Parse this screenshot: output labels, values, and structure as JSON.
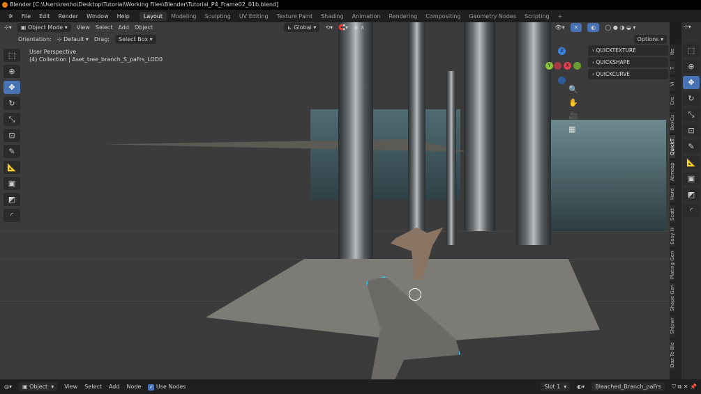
{
  "title": "Blender [C:\\Users\\renho\\Desktop\\Tutorial\\Working Files\\Blender\\Tutorial_P4_Frame02_01b.blend]",
  "menu": [
    "File",
    "Edit",
    "Render",
    "Window",
    "Help"
  ],
  "workspaces": [
    "Layout",
    "Modeling",
    "Sculpting",
    "UV Editing",
    "Texture Paint",
    "Shading",
    "Animation",
    "Rendering",
    "Compositing",
    "Geometry Nodes",
    "Scripting",
    "+"
  ],
  "header": {
    "mode": "Object Mode",
    "items": [
      "View",
      "Select",
      "Add",
      "Object"
    ],
    "orientation": "Global"
  },
  "tool_settings": {
    "orientation_label": "Orientation:",
    "orientation_value": "Default",
    "drag_label": "Drag:",
    "drag_value": "Select Box",
    "options": "Options"
  },
  "viewport": {
    "perspective": "User Perspective",
    "collection": "(4) Collection | Aset_tree_branch_S_paFrs_LOD0"
  },
  "gizmo": {
    "z": "Z",
    "y": "Y",
    "x": "X"
  },
  "panels": [
    "QUICKTEXTURE",
    "QUICKSHAPE",
    "QUICKCURVE"
  ],
  "side_tabs": [
    "Ite",
    "T",
    "Vi",
    "Cre",
    "BoxCu",
    "QuickT",
    "Atmosp",
    "Hard",
    "Scatt",
    "Easy H",
    "Plating Gen",
    "Shape Gen",
    "Shipwr",
    "Daz To Ble"
  ],
  "bottom": {
    "mode": "Object",
    "items": [
      "View",
      "Select",
      "Add",
      "Node"
    ],
    "use_nodes": "Use Nodes",
    "slot": "Slot 1",
    "material": "Bleached_Branch_paFrs"
  },
  "colors": {
    "accent": "#4772b3",
    "selection": "#35c6e8"
  }
}
